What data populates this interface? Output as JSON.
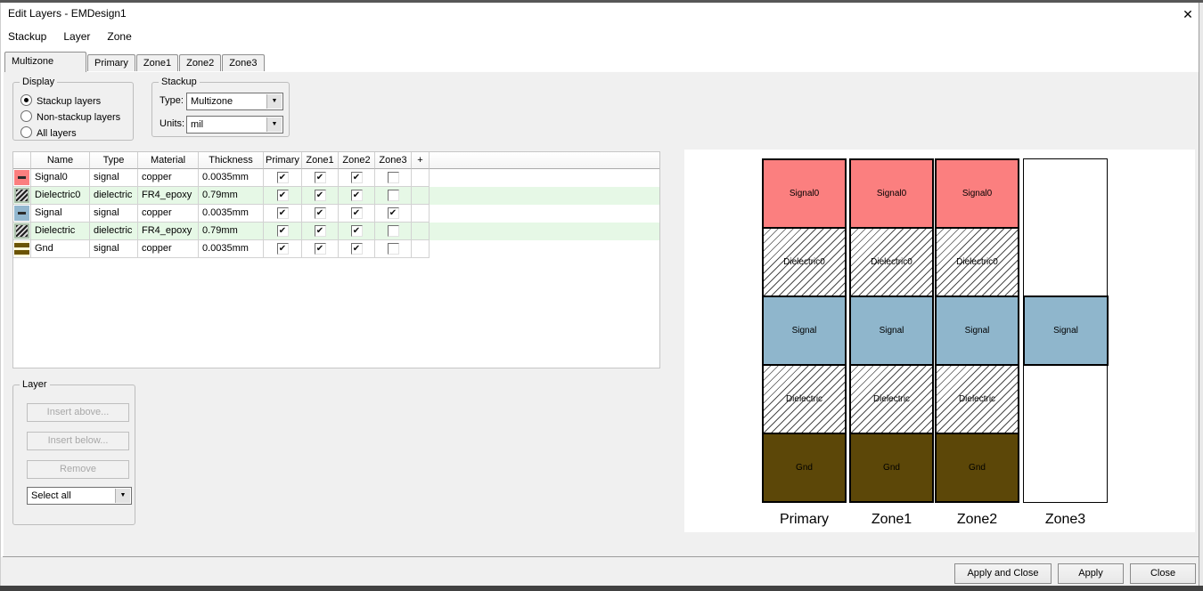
{
  "window": {
    "title": "Edit Layers - EMDesign1",
    "close_icon": "✕"
  },
  "menu": [
    "Stackup",
    "Layer",
    "Zone"
  ],
  "tabs": [
    {
      "label": "Multizone",
      "active": true
    },
    {
      "label": "Primary",
      "active": false
    },
    {
      "label": "Zone1",
      "active": false
    },
    {
      "label": "Zone2",
      "active": false
    },
    {
      "label": "Zone3",
      "active": false
    }
  ],
  "display_group": {
    "title": "Display",
    "options": [
      {
        "label": "Stackup layers",
        "selected": true
      },
      {
        "label": "Non-stackup layers",
        "selected": false
      },
      {
        "label": "All layers",
        "selected": false
      }
    ]
  },
  "stackup_group": {
    "title": "Stackup",
    "fields": [
      {
        "label": "Type:",
        "value": "Multizone"
      },
      {
        "label": "Units:",
        "value": "mil"
      }
    ]
  },
  "layer_table": {
    "headers": [
      "",
      "Name",
      "Type",
      "Material",
      "Thickness",
      "Primary",
      "Zone1",
      "Zone2",
      "Zone3",
      "+"
    ],
    "rows": [
      {
        "icon": "signal0",
        "name": "Signal0",
        "type": "signal",
        "material": "copper",
        "thickness": "0.0035mm",
        "checks": [
          true,
          true,
          true,
          false
        ],
        "highlight": false
      },
      {
        "icon": "dielectric",
        "name": "Dielectric0",
        "type": "dielectric",
        "material": "FR4_epoxy",
        "thickness": "0.79mm",
        "checks": [
          true,
          true,
          true,
          false
        ],
        "highlight": true
      },
      {
        "icon": "signal",
        "name": "Signal",
        "type": "signal",
        "material": "copper",
        "thickness": "0.0035mm",
        "checks": [
          true,
          true,
          true,
          true
        ],
        "highlight": false
      },
      {
        "icon": "dielectric",
        "name": "Dielectric",
        "type": "dielectric",
        "material": "FR4_epoxy",
        "thickness": "0.79mm",
        "checks": [
          true,
          true,
          true,
          false
        ],
        "highlight": true
      },
      {
        "icon": "gnd",
        "name": "Gnd",
        "type": "signal",
        "material": "copper",
        "thickness": "0.0035mm",
        "checks": [
          true,
          true,
          true,
          false
        ],
        "highlight": false
      }
    ]
  },
  "layer_group": {
    "title": "Layer",
    "buttons": [
      {
        "label": "Insert above...",
        "enabled": false
      },
      {
        "label": "Insert below...",
        "enabled": false
      },
      {
        "label": "Remove",
        "enabled": false
      }
    ],
    "select_value": "Select all"
  },
  "stackup_view": {
    "zones": [
      {
        "label": "Primary",
        "blocks": [
          "Signal0",
          "Dielectric0",
          "Signal",
          "Dielectric",
          "Gnd"
        ],
        "outlined": false
      },
      {
        "label": "Zone1",
        "blocks": [
          "Signal0",
          "Dielectric0",
          "Signal",
          "Dielectric",
          "Gnd"
        ],
        "outlined": false
      },
      {
        "label": "Zone2",
        "blocks": [
          "Signal0",
          "Dielectric0",
          "Signal",
          "Dielectric",
          "Gnd"
        ],
        "outlined": false
      },
      {
        "label": "Zone3",
        "blocks": [
          null,
          null,
          "Signal",
          null,
          null
        ],
        "outlined": true
      }
    ],
    "layer_styles": {
      "Signal0": {
        "fill": "solid",
        "color": "#fb7f7f"
      },
      "Dielectric0": {
        "fill": "hatch",
        "color": "#ffffff"
      },
      "Signal": {
        "fill": "solid",
        "color": "#8fb6cc"
      },
      "Dielectric": {
        "fill": "hatch",
        "color": "#ffffff"
      },
      "Gnd": {
        "fill": "solid",
        "color": "#5c4708"
      }
    }
  },
  "footer": {
    "buttons": [
      "Apply and Close",
      "Apply",
      "Close"
    ]
  },
  "colors": {
    "dialog_bg": "#f0f0f0",
    "titlebar_bg": "#ffffff",
    "highlight_row": "#e6f8e6",
    "signal0": "#fb7f7f",
    "signal": "#8fb6cc",
    "gnd": "#5c4708",
    "check_glyph": "✔",
    "dropdown_glyph": "▼"
  }
}
